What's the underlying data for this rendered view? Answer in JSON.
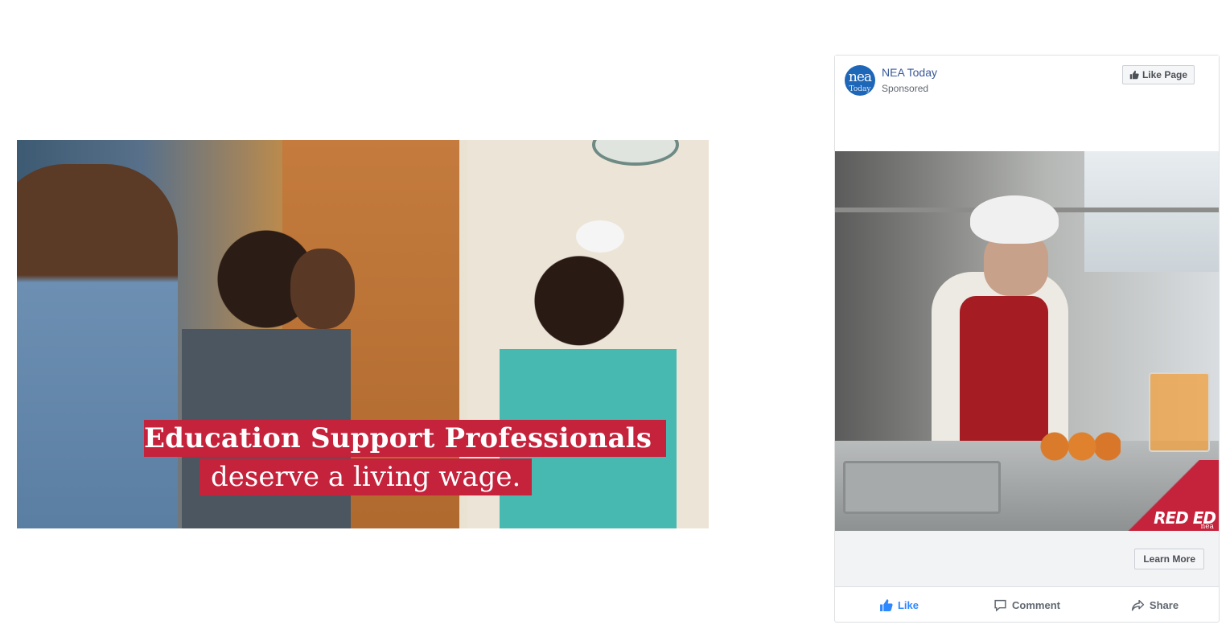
{
  "video": {
    "caption_line1": "Education Support Professionals",
    "caption_line2": "deserve a living wage."
  },
  "post": {
    "page_name": "NEA Today",
    "sponsored_label": "Sponsored",
    "avatar_text_top": "nea",
    "avatar_text_bottom": "Today",
    "like_page_label": "Like Page",
    "cta_label": "Learn More",
    "badge_text": "RED ED",
    "badge_sub": "nea",
    "actions": {
      "like": "Like",
      "comment": "Comment",
      "share": "Share"
    }
  },
  "colors": {
    "caption_red": "#c5223b",
    "facebook_blue": "#385898",
    "like_blue": "#2d88ff",
    "avatar_blue": "#1d66b8"
  },
  "icons": [
    "thumbs-up-icon",
    "comment-icon",
    "share-icon"
  ]
}
